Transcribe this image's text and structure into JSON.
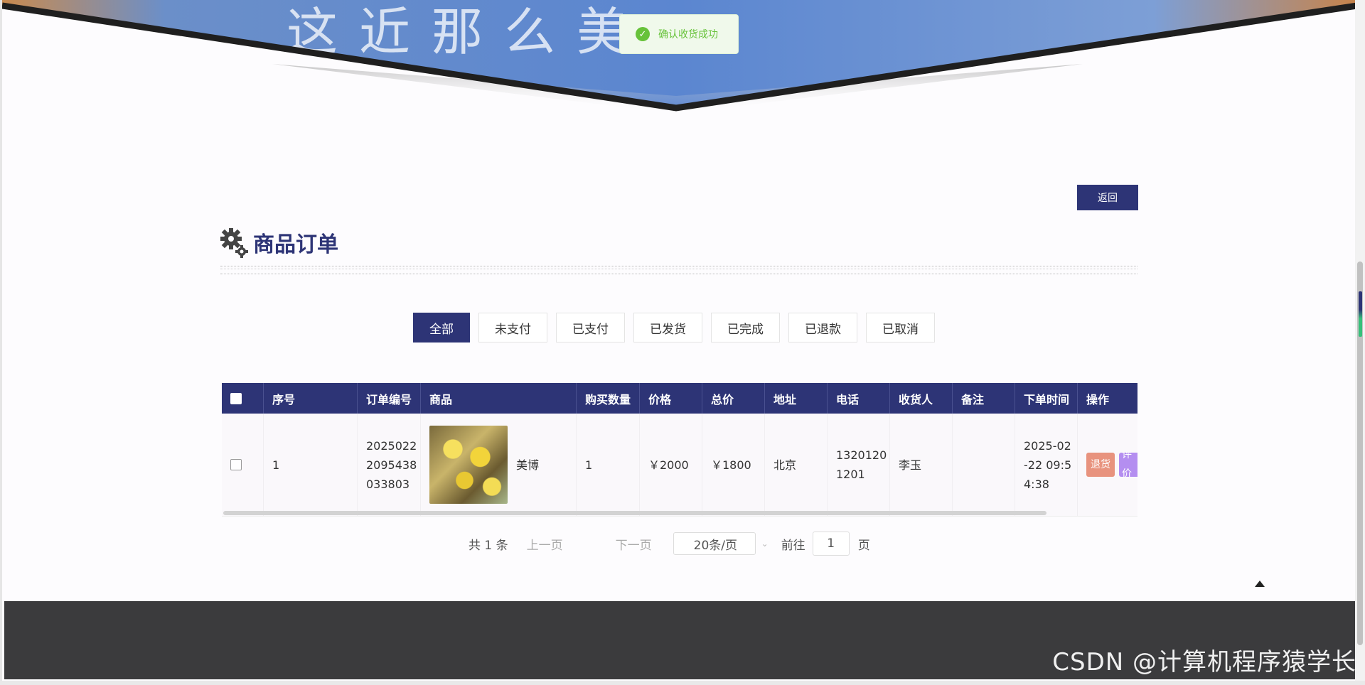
{
  "toast": {
    "message": "确认收货成功"
  },
  "banner": {
    "text": "这近那么美"
  },
  "back_button": "返回",
  "page_title": "商品订单",
  "tabs": [
    "全部",
    "未支付",
    "已支付",
    "已发货",
    "已完成",
    "已退款",
    "已取消"
  ],
  "active_tab": "全部",
  "table": {
    "headers": [
      "序号",
      "订单编号",
      "商品",
      "购买数量",
      "价格",
      "总价",
      "地址",
      "电话",
      "收货人",
      "备注",
      "下单时间",
      "操作"
    ],
    "rows": [
      {
        "index": "1",
        "order_no_lines": [
          "2025022",
          "2095438",
          "033803"
        ],
        "product": "美博",
        "quantity": "1",
        "price": "￥2000",
        "total": "￥1800",
        "address": "北京",
        "phone_lines": [
          "1320120",
          "1201"
        ],
        "receiver": "李玉",
        "remark": "",
        "time_lines": [
          "2025-02",
          "-22 09:5",
          "4:38"
        ],
        "actions": {
          "return": "退货",
          "review": "评价"
        }
      }
    ]
  },
  "pagination": {
    "total": "共 1 条",
    "prev": "上一页",
    "next": "下一页",
    "page_size": "20条/页",
    "goto_label": "前往",
    "page_value": "1",
    "page_suffix": "页"
  },
  "watermark": "CSDN @计算机程序猿学长"
}
